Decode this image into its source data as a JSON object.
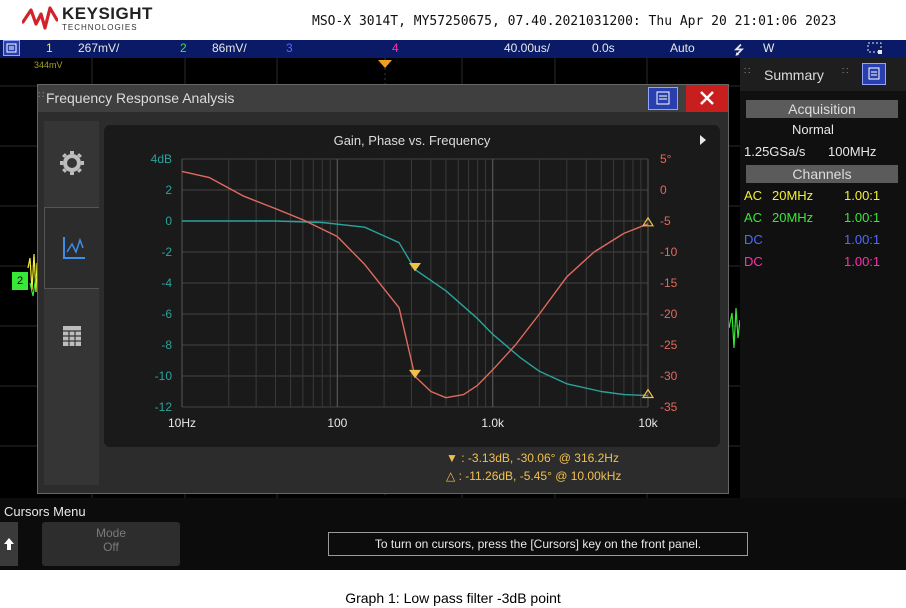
{
  "header": {
    "brand_name": "KEYSIGHT",
    "brand_subtitle": "TECHNOLOGIES",
    "device_info": "MSO-X 3014T, MY57250675, 07.40.2021031200: Thu Apr 20 21:01:06 2023"
  },
  "channel_bar": {
    "ch1_num": "1",
    "ch1_scale": "267mV/",
    "ch2_num": "2",
    "ch2_scale": "86mV/",
    "ch3_num": "3",
    "ch4_num": "4",
    "timebase": "40.00us/",
    "delay": "0.0s",
    "trigger_mode": "Auto",
    "trigger_source": "W"
  },
  "scope": {
    "offset_label": "344mV",
    "ch2_marker": "2"
  },
  "sidebar": {
    "title": "Summary",
    "acquisition_heading": "Acquisition",
    "acquisition_mode": "Normal",
    "sample_rate": "1.25GSa/s",
    "bandwidth": "100MHz",
    "channels_heading": "Channels",
    "channels": [
      {
        "coupling": "AC",
        "bw": "20MHz",
        "probe": "1.00:1",
        "color": "#f5f030"
      },
      {
        "coupling": "AC",
        "bw": "20MHz",
        "probe": "1.00:1",
        "color": "#38e838"
      },
      {
        "coupling": "DC",
        "bw": "",
        "probe": "1.00:1",
        "color": "#4f6bff"
      },
      {
        "coupling": "DC",
        "bw": "",
        "probe": "1.00:1",
        "color": "#ff2fb0"
      }
    ]
  },
  "fra": {
    "window_title": "Frequency Response Analysis",
    "plot_title": "Gain, Phase vs. Frequency",
    "cursor1": {
      "marker": "▼",
      "text": ": -3.13dB, -30.06° @ 316.2Hz"
    },
    "cursor2": {
      "marker": "△",
      "text": ": -11.26dB, -5.45° @ 10.00kHz"
    }
  },
  "softkeys": {
    "menu_title": "Cursors Menu",
    "mode_label": "Mode",
    "mode_value": "Off",
    "hint": "To turn on cursors, press the [Cursors] key on the front panel."
  },
  "caption": "Graph 1: Low pass filter -3dB point",
  "chart_data": {
    "type": "line",
    "title": "Gain, Phase vs. Frequency",
    "x_scale": "log",
    "x_tick_labels": [
      "10Hz",
      "100",
      "1.0k",
      "10k"
    ],
    "x_ticks": [
      10,
      100,
      1000,
      10000
    ],
    "xlim": [
      10,
      10000
    ],
    "y_left": {
      "tick_labels": [
        "4dB",
        "2",
        "0",
        "-2",
        "-4",
        "-6",
        "-8",
        "-10",
        "-12"
      ],
      "ylim": [
        -12,
        4
      ]
    },
    "y_right": {
      "tick_labels": [
        "5°",
        "0",
        "-5",
        "-10",
        "-15",
        "-20",
        "-25",
        "-30",
        "-35"
      ],
      "ylim": [
        -35,
        5
      ]
    },
    "grid": true,
    "series": [
      {
        "axis": "left",
        "color": "#2aa39a",
        "x": [
          10,
          20,
          40,
          80,
          150,
          250,
          316.2,
          500,
          800,
          1000,
          1500,
          2000,
          3000,
          5000,
          7000,
          10000
        ],
        "y": [
          0,
          0,
          0,
          -0.1,
          -0.4,
          -1.4,
          -3.13,
          -4.5,
          -6.3,
          -7.3,
          -8.8,
          -9.7,
          -10.5,
          -11.0,
          -11.2,
          -11.26
        ]
      },
      {
        "axis": "right",
        "color": "#e06a60",
        "x": [
          10,
          15,
          25,
          40,
          60,
          100,
          150,
          250,
          316.2,
          400,
          500,
          650,
          800,
          1000,
          1400,
          2000,
          3000,
          4500,
          7000,
          10000
        ],
        "y": [
          3.0,
          2.0,
          -1.0,
          -3.0,
          -4.8,
          -7.5,
          -12,
          -19,
          -30.06,
          -32.5,
          -33.5,
          -33.0,
          -31.5,
          -29.0,
          -25,
          -20,
          -14,
          -10,
          -7,
          -5.45
        ]
      }
    ],
    "markers": [
      {
        "symbol": "filled-triangle-down",
        "x": 316.2,
        "gain": -3.13,
        "phase": -30.06
      },
      {
        "symbol": "hollow-triangle-up",
        "x": 10000,
        "gain": -11.26,
        "phase": -5.45
      }
    ]
  }
}
